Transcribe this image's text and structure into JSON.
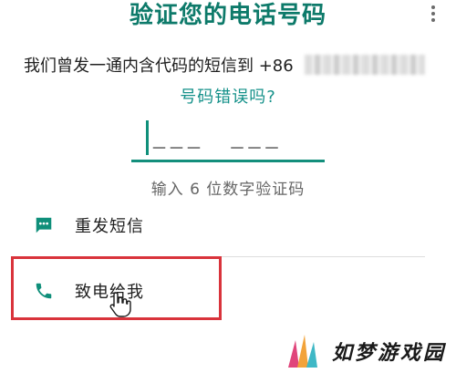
{
  "screen": {
    "title": "验证您的电话号码",
    "menu_icon": "more-vert-icon"
  },
  "verification": {
    "sent_message": "我们曾发一通内含代码的短信到 +86",
    "wrong_number_link": "号码错误吗?",
    "code_placeholder": "___  ___",
    "code_hint": "输入 6 位数字验证码"
  },
  "actions": [
    {
      "label": "重发短信",
      "icon": "sms-icon"
    },
    {
      "label": "致电给我",
      "icon": "phone-icon"
    }
  ],
  "colors": {
    "accent": "#0d7a6a",
    "link": "#15918a",
    "highlight": "#d9333b"
  },
  "watermark": {
    "text": "如梦游戏园",
    "logo": "rumeng-logo"
  }
}
